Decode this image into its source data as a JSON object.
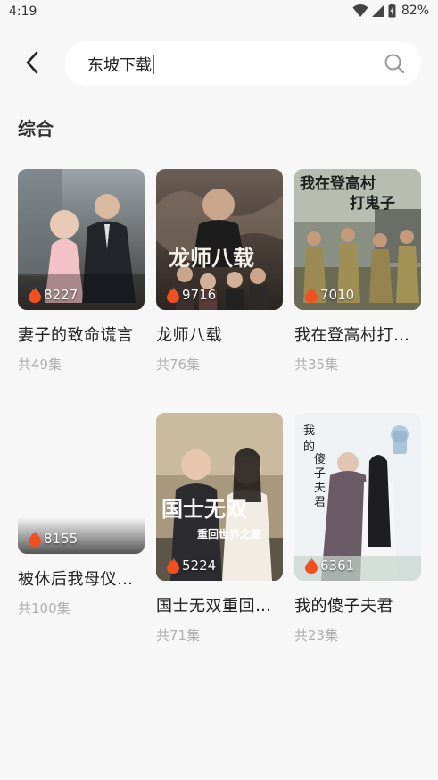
{
  "status": {
    "time": "4:19",
    "battery": "82%"
  },
  "search": {
    "query": "东坡下载"
  },
  "section_title": "综合",
  "colors": {
    "accent": "#2f6fe4",
    "flame": "#f0501e"
  },
  "cards": [
    {
      "title": "妻子的致命谎言",
      "episodes": "共49集",
      "views": "8227"
    },
    {
      "title": "龙师八载",
      "episodes": "共76集",
      "views": "9716"
    },
    {
      "title": "我在登高村打…",
      "episodes": "共35集",
      "views": "7010"
    },
    {
      "title": "被休后我母仪…",
      "episodes": "共100集",
      "views": "8155"
    },
    {
      "title": "国士无双重回…",
      "episodes": "共71集",
      "views": "5224"
    },
    {
      "title": "我的傻子夫君",
      "episodes": "共23集",
      "views": "6361"
    }
  ]
}
